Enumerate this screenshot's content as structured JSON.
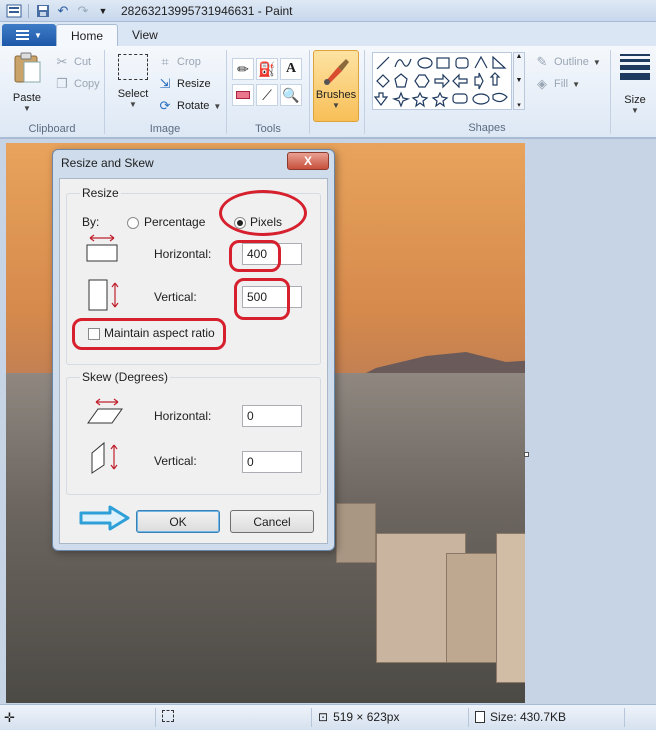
{
  "window": {
    "title": "28263213995731946631 - Paint"
  },
  "tabs": {
    "file_label": "",
    "home": "Home",
    "view": "View"
  },
  "clipboard": {
    "paste": "Paste",
    "cut": "Cut",
    "copy": "Copy",
    "label": "Clipboard"
  },
  "image": {
    "select": "Select",
    "crop": "Crop",
    "resize": "Resize",
    "rotate": "Rotate",
    "label": "Image"
  },
  "tools": {
    "label": "Tools"
  },
  "brushes": {
    "label": "Brushes"
  },
  "shapes": {
    "outline": "Outline",
    "fill": "Fill",
    "label": "Shapes"
  },
  "size": {
    "label": "Size"
  },
  "dialog": {
    "title": "Resize and Skew",
    "close": "X",
    "resize_legend": "Resize",
    "by_label": "By:",
    "percentage": "Percentage",
    "pixels": "Pixels",
    "horizontal_label": "Horizontal:",
    "horizontal_value": "400",
    "vertical_label": "Vertical:",
    "vertical_value": "500",
    "maintain_aspect": "Maintain aspect ratio",
    "skew_legend": "Skew (Degrees)",
    "skew_horizontal_label": "Horizontal:",
    "skew_horizontal_value": "0",
    "skew_vertical_label": "Vertical:",
    "skew_vertical_value": "0",
    "ok": "OK",
    "cancel": "Cancel",
    "pixels_selected": true,
    "maintain_checked": false
  },
  "status": {
    "dimensions": "519 × 623px",
    "size": "Size: 430.7KB"
  },
  "colors": {
    "annotation_red": "#d6202e",
    "annotation_blue": "#2f9fd8",
    "file_tab": "#1d58a8"
  }
}
